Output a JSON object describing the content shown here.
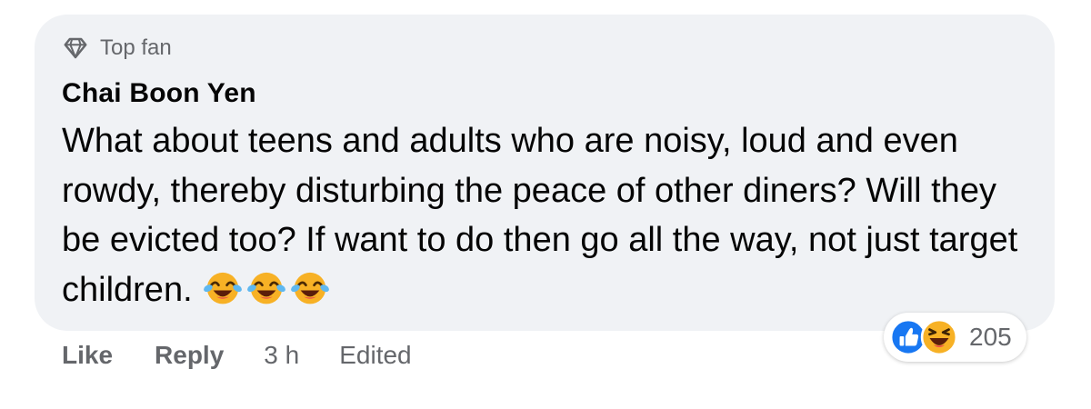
{
  "comment": {
    "badge": "Top fan",
    "author": "Chai Boon Yen",
    "text": "What about teens and adults who are noisy, loud and even rowdy, thereby disturbing the peace of other diners? Will they be evicted too? If want to do then go all the way, not just target children.",
    "text_emojis": [
      "laughing-crying-emoji",
      "laughing-crying-emoji",
      "laughing-crying-emoji"
    ]
  },
  "reactions": {
    "icons": [
      "like-reaction-icon",
      "haha-reaction-icon"
    ],
    "count": "205"
  },
  "actions": {
    "like": "Like",
    "reply": "Reply",
    "time": "3 h",
    "edited": "Edited"
  },
  "colors": {
    "bubble_bg": "#f0f2f5",
    "text": "#050505",
    "secondary": "#65676b",
    "like_blue": "#1877f2",
    "haha_yellow": "#f7b125"
  }
}
